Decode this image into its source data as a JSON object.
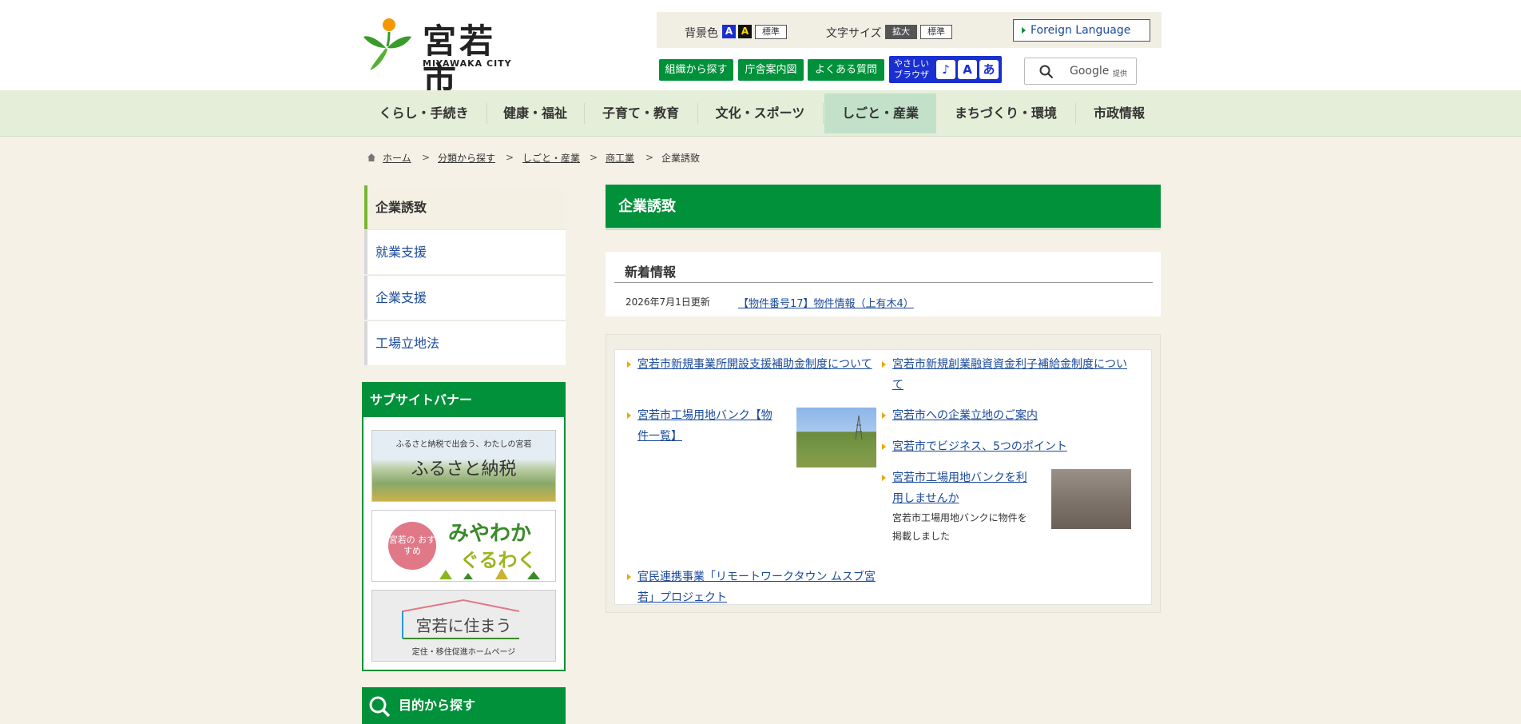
{
  "header": {
    "logo_main": "宮若市",
    "logo_sub": "MIYAWAKA CITY",
    "bg_color_label": "背景色",
    "bg_blue": "A",
    "bg_black": "A",
    "bg_standard": "標準",
    "font_size_label": "文字サイズ",
    "font_enlarge": "拡大",
    "font_standard": "標準",
    "foreign_language": "Foreign Language",
    "btn_org": "組織から探す",
    "btn_floor": "庁舎案内図",
    "btn_faq": "よくある質問",
    "easy_browser": "やさしい ブラウザ",
    "easy_icons": [
      "♪",
      "A",
      "あ"
    ],
    "search_label": "Google",
    "search_sub": "提供"
  },
  "gnav": [
    "くらし・手続き",
    "健康・福祉",
    "子育て・教育",
    "文化・スポーツ",
    "しごと・産業",
    "まちづくり・環境",
    "市政情報"
  ],
  "breadcrumb": [
    "ホーム",
    "分類から探す",
    "しごと・産業",
    "商工業",
    "企業誘致"
  ],
  "sidebar": {
    "items": [
      "企業誘致",
      "就業支援",
      "企業支援",
      "工場立地法"
    ],
    "banner_title": "サブサイトバナー",
    "banner1_line1": "ふるさと納税で出会う、わたしの宮若",
    "banner1_line2": "ふるさと納税",
    "banner2_badge": "宮若の おすすめ",
    "banner2_line1": "みやわか",
    "banner2_line2": "ぐるわく",
    "banner3_line1": "宮若に住まう",
    "banner3_line2": "定住・移住促進ホームページ",
    "purpose_title": "目的から探す"
  },
  "main": {
    "title": "企業誘致",
    "news_heading": "新着情報",
    "news_date": "2026年7月1日更新",
    "news_link": "【物件番号17】物件情報（上有木4）",
    "links": [
      "宮若市新規事業所開設支援補助金制度について",
      "宮若市新規創業融資資金利子補給金制度について",
      "宮若市工場用地バンク【物件一覧】",
      "宮若市への企業立地のご案内",
      "宮若市でビジネス、5つのポイント",
      "宮若市工場用地バンクを利用しませんか",
      "官民連携事業「リモートワークタウン ムスブ宮若」プロジェクト"
    ],
    "link6_desc": "宮若市工場用地バンクに物件を掲載しました"
  },
  "colors": {
    "brand_green": "#00913a",
    "nav_bg": "#e4eed8",
    "nav_active": "#c3e1c9",
    "link": "#1a4a9a",
    "marker": "#f0a500"
  },
  "icons": [
    "home-icon",
    "search-icon",
    "speaker-icon",
    "ruby-icon",
    "hiragana-icon",
    "magnifier-icon"
  ]
}
